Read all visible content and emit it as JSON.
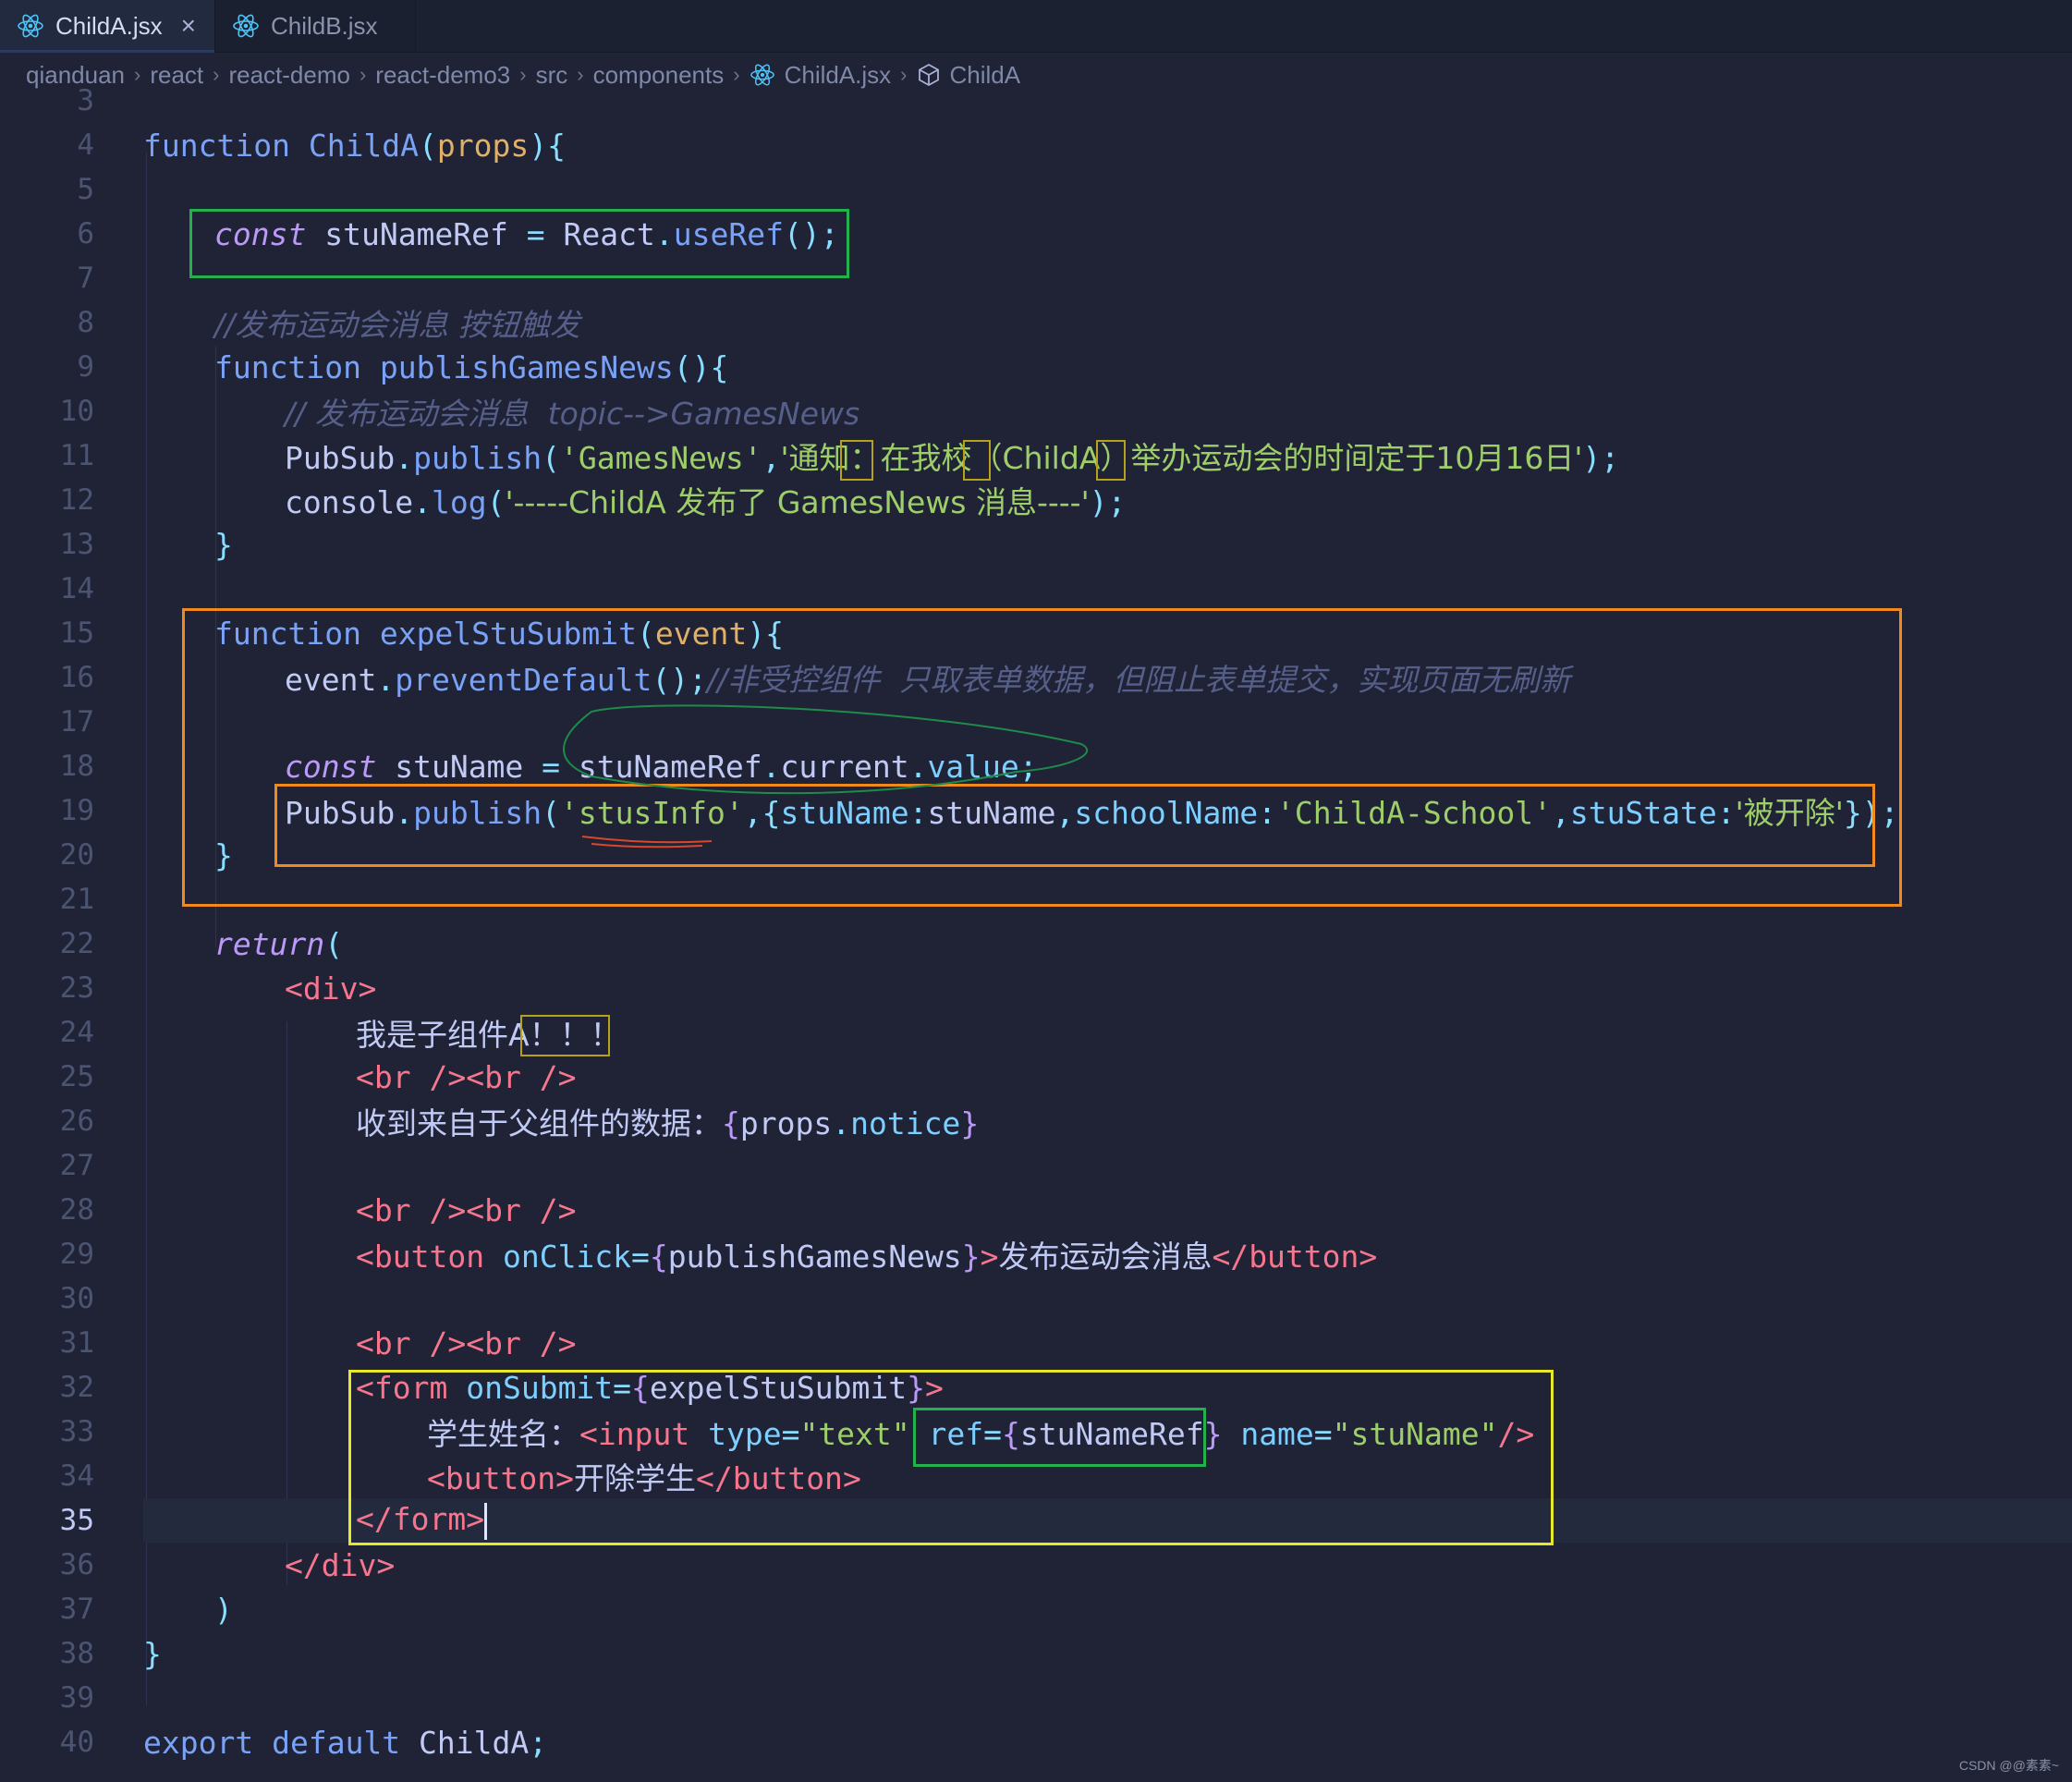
{
  "tabs": [
    {
      "label": "ChildA.jsx",
      "active": true,
      "close": "×"
    },
    {
      "label": "ChildB.jsx",
      "active": false
    }
  ],
  "breadcrumb": [
    "qianduan",
    "react",
    "react-demo",
    "react-demo3",
    "src",
    "components",
    "ChildA.jsx",
    "ChildA"
  ],
  "code": {
    "ln": [
      "3",
      "4",
      "5",
      "6",
      "7",
      "8",
      "9",
      "10",
      "11",
      "12",
      "13",
      "14",
      "15",
      "16",
      "17",
      "18",
      "19",
      "20",
      "21",
      "22",
      "23",
      "24",
      "25",
      "26",
      "27",
      "28",
      "29",
      "30",
      "31",
      "32",
      "33",
      "34",
      "35",
      "36",
      "37",
      "38",
      "39",
      "40"
    ],
    "l4": {
      "kw": "function",
      "name": "ChildA",
      "open": "(",
      "param": "props",
      "close": "){"
    },
    "l6": {
      "kw": "const",
      "name": "stuNameRef",
      "eq": "=",
      "obj": "React",
      "dot": ".",
      "method": "useRef",
      "tail": "();"
    },
    "l8": {
      "comment": "//发布运动会消息 按钮触发"
    },
    "l9": {
      "kw": "function",
      "name": "publishGamesNews",
      "tail": "(){"
    },
    "l10": {
      "comment": "// 发布运动会消息  topic-->GamesNews"
    },
    "l11": {
      "obj": "PubSub",
      "dot": ".",
      "method": "publish",
      "open": "(",
      "s1": "'GamesNews'",
      "comma": ",",
      "s2": "'通知：在我校（ChildA）举办运动会的时间定于10月16日'",
      "close": ");"
    },
    "l12": {
      "obj": "console",
      "dot": ".",
      "method": "log",
      "open": "(",
      "s1": "'-----ChildA 发布了 GamesNews 消息----'",
      "close": ");"
    },
    "l13": {
      "text": "}"
    },
    "l15": {
      "kw": "function",
      "name": "expelStuSubmit",
      "open": "(",
      "param": "event",
      "close": "){"
    },
    "l16": {
      "obj": "event",
      "dot": ".",
      "method": "preventDefault",
      "tail": "();",
      "comment": "//非受控组件  只取表单数据，但阻止表单提交，实现页面无刷新"
    },
    "l18": {
      "kw": "const",
      "name": "stuName",
      "eq": "=",
      "obj": "stuNameRef",
      "dot1": ".",
      "p1": "current",
      "dot2": ".",
      "p2": "value",
      "tail": ";"
    },
    "l19": {
      "obj": "PubSub",
      "dot": ".",
      "method": "publish",
      "open": "(",
      "s1": "'stusInfo'",
      "comma": ",",
      "ob": "{",
      "k1": "stuName",
      "c1": ":",
      "v1": "stuName",
      "cm1": ",",
      "k2": "schoolName",
      "c2": ":",
      "v2": "'ChildA-School'",
      "cm2": ",",
      "k3": "stuState",
      "c3": ":",
      "v3": "'被开除'",
      "cb": "}",
      "close": ");"
    },
    "l20": {
      "text": "}"
    },
    "l22": {
      "kw": "return",
      "open": "("
    },
    "l23": {
      "open": "<",
      "tag": "div",
      "close": ">"
    },
    "l24": {
      "text": "我是子组件A！！！"
    },
    "l25": {
      "a": "<",
      "b": "br",
      "c": " />",
      "d": "<",
      "e": "br",
      "f": " />"
    },
    "l26": {
      "text": "收到来自于父组件的数据：",
      "ob": "{",
      "obj": "props",
      "dot": ".",
      "prop": "notice",
      "cb": "}"
    },
    "l28": {
      "a": "<",
      "b": "br",
      "c": " />",
      "d": "<",
      "e": "br",
      "f": " />"
    },
    "l29": {
      "open": "<",
      "tag": "button",
      "attr": " onClick",
      "eq": "=",
      "ob": "{",
      "val": "publishGamesNews",
      "cb": "}",
      "gt": ">",
      "text": "发布运动会消息",
      "end": "</",
      "etag": "button",
      "egt": ">"
    },
    "l31": {
      "a": "<",
      "b": "br",
      "c": " />",
      "d": "<",
      "e": "br",
      "f": " />"
    },
    "l32": {
      "open": "<",
      "tag": "form",
      "attr": " onSubmit",
      "eq": "=",
      "ob": "{",
      "val": "expelStuSubmit",
      "cb": "}",
      "gt": ">"
    },
    "l33": {
      "label": "学生姓名：",
      "open": "<",
      "tag": "input",
      "a1": " type",
      "eq1": "=",
      "v1": "\"text\"",
      "a2": " ref",
      "eq2": "=",
      "ob": "{",
      "v2": "stuNameRef",
      "cb": "}",
      "a3": " name",
      "eq3": "=",
      "v3": "\"stuName\"",
      "end": "/>"
    },
    "l34": {
      "open": "<",
      "tag": "button",
      "gt": ">",
      "text": "开除学生",
      "end": "</",
      "etag": "button",
      "egt": ">"
    },
    "l35": {
      "end": "</",
      "etag": "form",
      "egt": ">"
    },
    "l36": {
      "end": "</",
      "etag": "div",
      "egt": ">"
    },
    "l37": {
      "text": ")"
    },
    "l38": {
      "text": "}"
    },
    "l40": {
      "kw1": "export",
      "kw2": "default",
      "name": "ChildA",
      "tail": ";"
    }
  },
  "watermark": "CSDN @@素素~",
  "colors": {
    "green_box": "#22b14c",
    "orange_box": "#f08a1c",
    "yellow_box": "#e8e82a"
  }
}
